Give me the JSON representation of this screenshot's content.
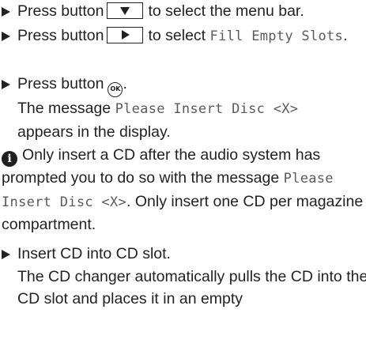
{
  "steps": [
    {
      "before": "Press button",
      "button_icon": "down-arrow-button-icon",
      "after": "to select the menu bar."
    },
    {
      "before": "Press button",
      "button_icon": "right-arrow-button-icon",
      "after": "to select",
      "code": "Fill Empty Slots",
      "end": "."
    },
    {
      "before": "Press button",
      "button_label": "OK",
      "end": ".",
      "result_before": "The message",
      "result_code": "Please Insert Disc <X>",
      "result_after": "appears in the display."
    }
  ],
  "note": {
    "icon": "info-icon",
    "icon_glyph": "i",
    "text1": "Only insert a CD after the audio system has prompted you to do so with the message",
    "code": "Please Insert Disc <X>",
    "text2": ". Only insert one CD per magazine compartment."
  },
  "step4": {
    "text": "Insert CD into CD slot.",
    "result": "The CD changer automatically pulls the CD into the CD slot and places it in an empty"
  }
}
